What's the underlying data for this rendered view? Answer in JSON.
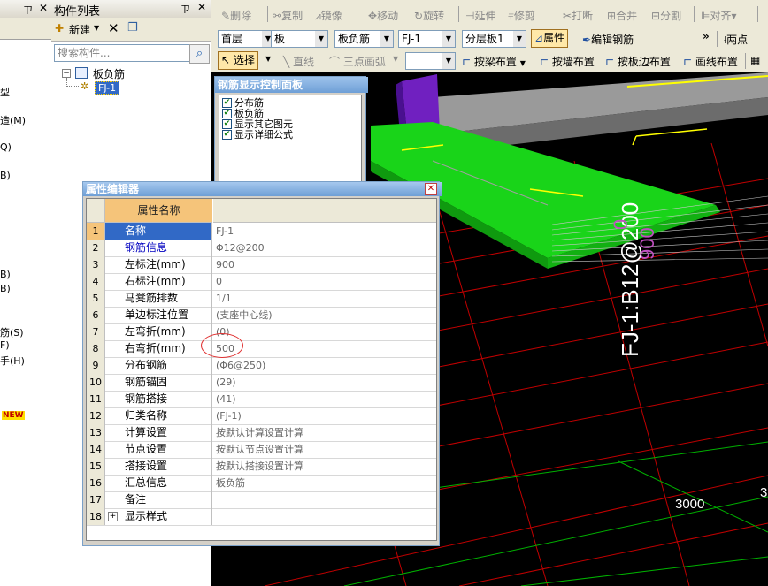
{
  "left_strip": {
    "labels": [
      "型",
      "造(M)",
      "Q)",
      "B)",
      "B)",
      "B)",
      "筋(S)",
      "F)",
      "手(H)"
    ],
    "new_badge": "NEW"
  },
  "component_panel": {
    "title": "构件列表",
    "new_label": "新建",
    "search_placeholder": "搜索构件...",
    "tree_root": "板负筋",
    "tree_child": "FJ-1"
  },
  "toolbar1": {
    "delete": "删除",
    "copy": "复制",
    "mirror": "镜像",
    "move": "移动",
    "rotate": "旋转",
    "extend": "延伸",
    "trim": "修剪",
    "break": "打断",
    "merge": "合并",
    "split": "分割",
    "align": "对齐"
  },
  "toolbar2": {
    "floor": "首层",
    "category": "板",
    "type": "板负筋",
    "component": "FJ-1",
    "layer": "分层板1",
    "properties": "属性",
    "edit_rebar": "编辑钢筋",
    "two_points": "两点"
  },
  "toolbar3": {
    "select": "选择",
    "line": "直线",
    "arc": "三点画弧",
    "by_beam": "按梁布置",
    "by_wall": "按墙布置",
    "by_slab_edge": "按板边布置",
    "draw_line": "画线布置"
  },
  "rebar_panel": {
    "title": "钢筋显示控制面板",
    "items": [
      "分布筋",
      "板负筋",
      "显示其它图元",
      "显示详细公式"
    ]
  },
  "property_editor": {
    "title": "属性编辑器",
    "col_name": "属性名称",
    "rows": [
      {
        "n": "1",
        "k": "名称",
        "v": "FJ-1"
      },
      {
        "n": "2",
        "k": "钢筋信息",
        "v": "Φ12@200"
      },
      {
        "n": "3",
        "k": "左标注(mm)",
        "v": "900"
      },
      {
        "n": "4",
        "k": "右标注(mm)",
        "v": "0"
      },
      {
        "n": "5",
        "k": "马凳筋排数",
        "v": "1/1"
      },
      {
        "n": "6",
        "k": "单边标注位置",
        "v": "(支座中心线)"
      },
      {
        "n": "7",
        "k": "左弯折(mm)",
        "v": "(0)"
      },
      {
        "n": "8",
        "k": "右弯折(mm)",
        "v": "500"
      },
      {
        "n": "9",
        "k": "分布钢筋",
        "v": "(Φ6@250)"
      },
      {
        "n": "10",
        "k": "钢筋锚固",
        "v": "(29)"
      },
      {
        "n": "11",
        "k": "钢筋搭接",
        "v": "(41)"
      },
      {
        "n": "12",
        "k": "归类名称",
        "v": "(FJ-1)"
      },
      {
        "n": "13",
        "k": "计算设置",
        "v": "按默认计算设置计算"
      },
      {
        "n": "14",
        "k": "节点设置",
        "v": "按默认节点设置计算"
      },
      {
        "n": "15",
        "k": "搭接设置",
        "v": "按默认搭接设置计算"
      },
      {
        "n": "16",
        "k": "汇总信息",
        "v": "板负筋"
      },
      {
        "n": "17",
        "k": "备注",
        "v": ""
      },
      {
        "n": "18",
        "k": "显示样式",
        "v": ""
      }
    ]
  },
  "viewport": {
    "label_vertical": "FJ-1:B12@200",
    "dim_labels": [
      "0",
      "900"
    ],
    "axis_label": "3000",
    "axis_label_edge": "3"
  },
  "colors": {
    "slab_green": "#19d419",
    "beam_gray": "#9a9a9a",
    "column_purple": "#7020c0",
    "grid_red": "#c00000",
    "grid_green": "#00b000",
    "title_blue": "#6e9fd6",
    "selected_row": "#3169c6"
  }
}
